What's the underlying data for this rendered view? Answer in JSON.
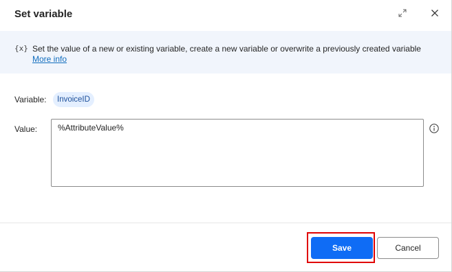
{
  "dialog": {
    "title": "Set variable"
  },
  "info": {
    "icon_text": "{x}",
    "description": "Set the value of a new or existing variable, create a new variable or overwrite a previously created variable",
    "link_text": "More info"
  },
  "fields": {
    "variable_label": "Variable:",
    "variable_value": "InvoiceID",
    "value_label": "Value:",
    "value_text": "%AttributeValue%"
  },
  "footer": {
    "save_label": "Save",
    "cancel_label": "Cancel"
  },
  "colors": {
    "accent": "#0f6cf5",
    "highlight": "#e00000",
    "banner": "#f1f5fc",
    "chip": "#e4efff"
  }
}
